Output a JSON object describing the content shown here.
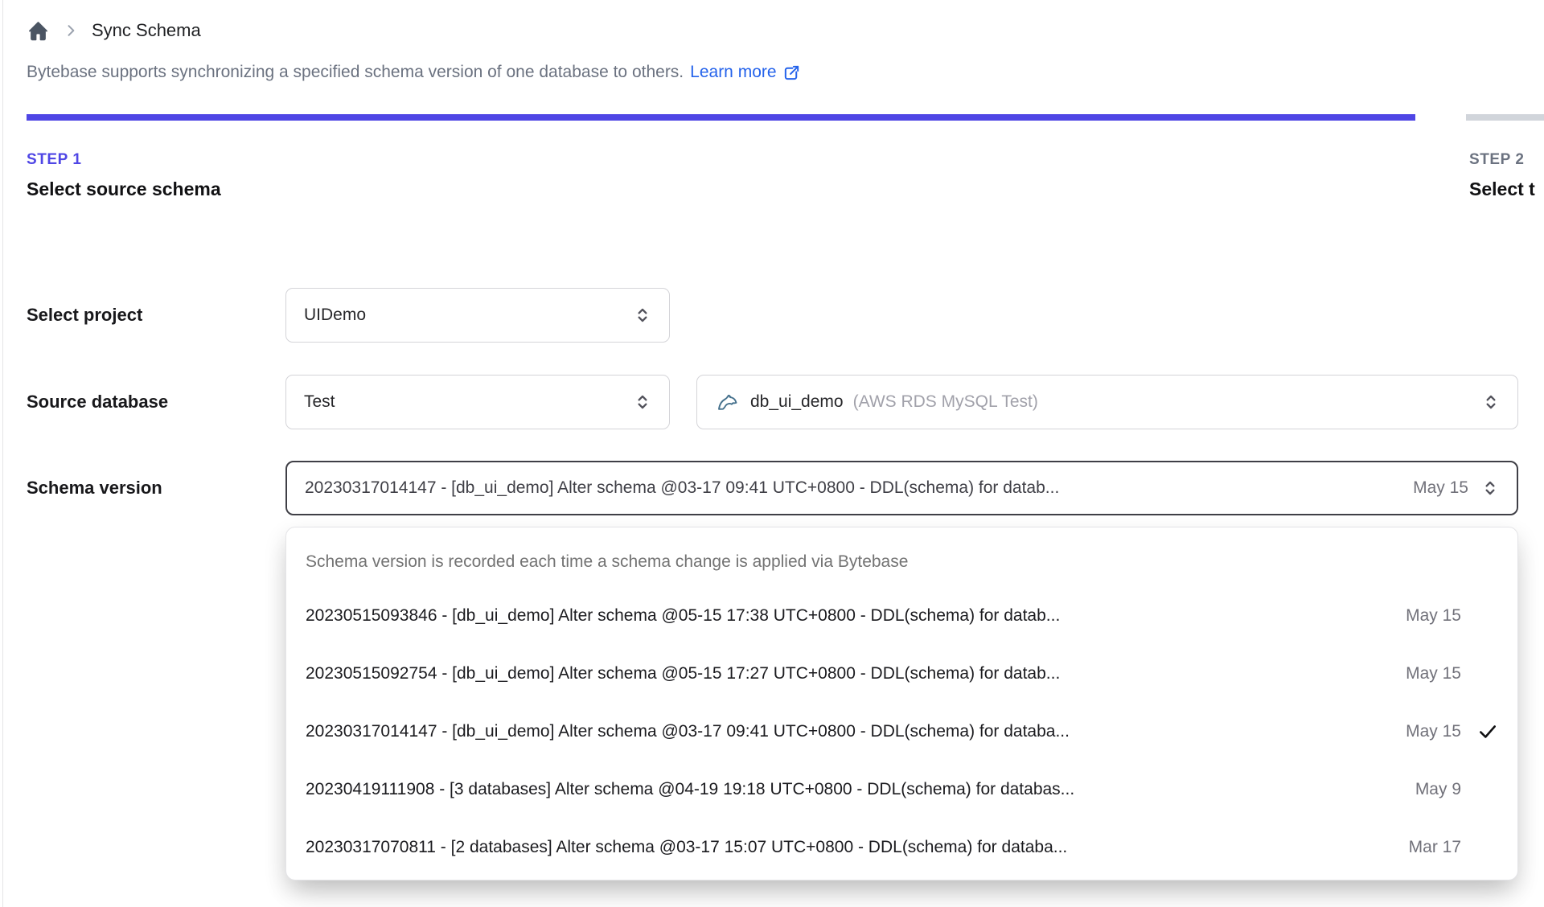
{
  "breadcrumb": {
    "title": "Sync Schema"
  },
  "description": {
    "text": "Bytebase supports synchronizing a specified schema version of one database to others.",
    "link_label": "Learn more"
  },
  "steps": [
    {
      "id": "STEP 1",
      "title": "Select source schema"
    },
    {
      "id": "STEP 2",
      "title": "Select t"
    }
  ],
  "form": {
    "project": {
      "label": "Select project",
      "value": "UIDemo"
    },
    "source_database": {
      "label": "Source database",
      "environment_value": "Test",
      "database_value": "db_ui_demo",
      "database_annotation": "(AWS RDS MySQL Test)"
    },
    "schema_version": {
      "label": "Schema version",
      "value": "20230317014147 - [db_ui_demo] Alter schema @03-17 09:41 UTC+0800 - DDL(schema) for datab...",
      "date": "May 15"
    }
  },
  "dropdown": {
    "note": "Schema version is recorded each time a schema change is applied via Bytebase",
    "options": [
      {
        "text": "20230515093846 - [db_ui_demo] Alter schema @05-15 17:38 UTC+0800 - DDL(schema) for datab...",
        "date": "May 15",
        "selected": false
      },
      {
        "text": "20230515092754 - [db_ui_demo] Alter schema @05-15 17:27 UTC+0800 - DDL(schema) for datab...",
        "date": "May 15",
        "selected": false
      },
      {
        "text": "20230317014147 - [db_ui_demo] Alter schema @03-17 09:41 UTC+0800 - DDL(schema) for databa...",
        "date": "May 15",
        "selected": true
      },
      {
        "text": "20230419111908 - [3 databases] Alter schema @04-19 19:18 UTC+0800 - DDL(schema) for databas...",
        "date": "May 9",
        "selected": false
      },
      {
        "text": "20230317070811 - [2 databases] Alter schema @03-17 15:07 UTC+0800 - DDL(schema) for databa...",
        "date": "Mar 17",
        "selected": false
      }
    ]
  },
  "colors": {
    "accent": "#4f46e5",
    "link": "#2563eb",
    "progress_upcoming": "#d1d5db"
  }
}
